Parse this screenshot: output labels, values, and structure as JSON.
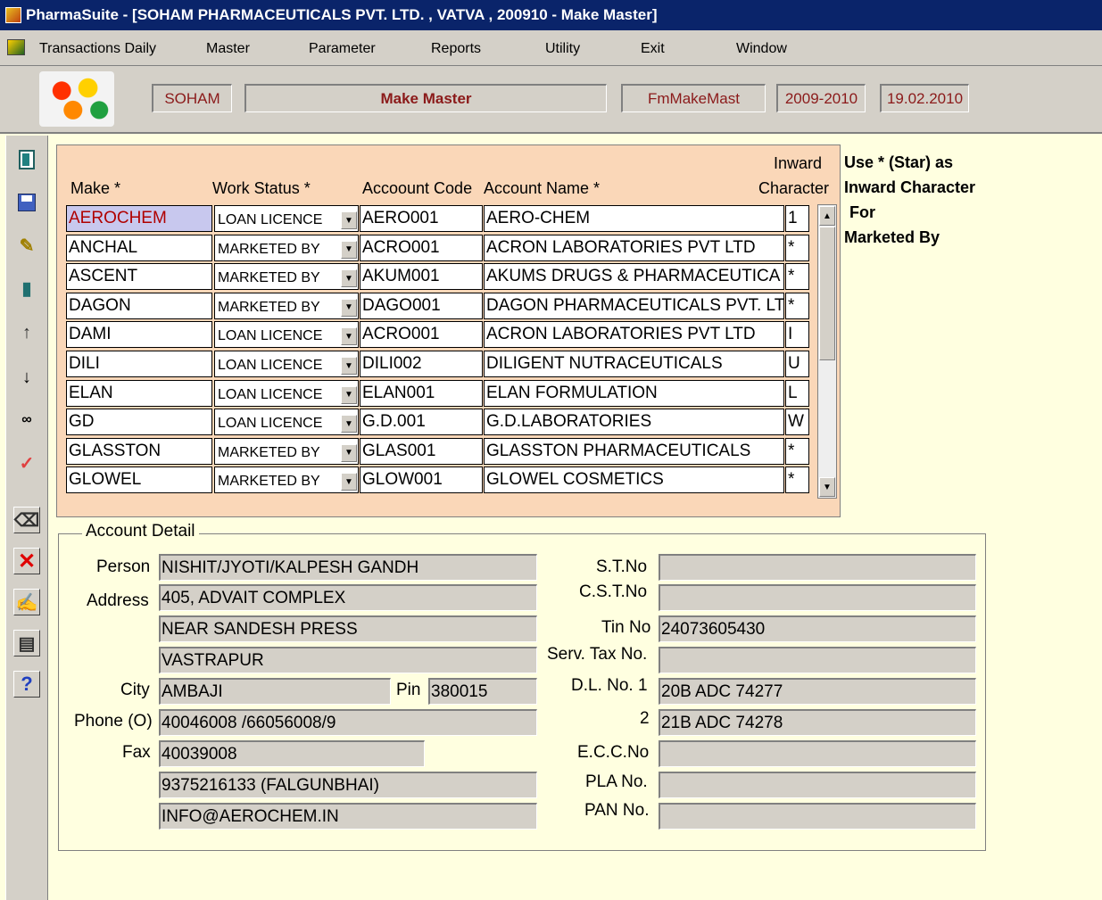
{
  "window": {
    "title": "PharmaSuite - [SOHAM PHARMACEUTICALS PVT. LTD. , VATVA , 200910 - Make Master]"
  },
  "menu": [
    "Transactions Daily",
    "Master",
    "Parameter",
    "Reports",
    "Utility",
    "Exit",
    "Window"
  ],
  "header": {
    "company": "SOHAM",
    "form_title": "Make Master",
    "form_code": "FmMakeMast",
    "year": "2009-2010",
    "date": "19.02.2010"
  },
  "toolbar": [
    "frame-icon",
    "save-icon",
    "edit-icon",
    "exit-door-icon",
    "arrow-up-icon",
    "arrow-down-icon",
    "binoculars-icon",
    "check-icon",
    "eraser-icon",
    "delete-icon",
    "pen-icon",
    "print-icon",
    "help-icon"
  ],
  "grid": {
    "headers": {
      "make": "Make *",
      "work_status": "Work Status *",
      "account_code": "Accoount Code",
      "account_name": "Account Name *",
      "inward_1": "Inward",
      "inward_2": "Character"
    },
    "rows": [
      {
        "make": "AEROCHEM",
        "status": "LOAN LICENCE",
        "code": "AERO001",
        "name": "AERO-CHEM",
        "inward": "1"
      },
      {
        "make": "ANCHAL",
        "status": "MARKETED BY",
        "code": "ACRO001",
        "name": "ACRON LABORATORIES PVT LTD",
        "inward": "*"
      },
      {
        "make": "ASCENT",
        "status": "MARKETED BY",
        "code": "AKUM001",
        "name": "AKUMS DRUGS & PHARMACEUTICA",
        "inward": "*"
      },
      {
        "make": "DAGON",
        "status": "MARKETED BY",
        "code": "DAGO001",
        "name": "DAGON PHARMACEUTICALS PVT. LT",
        "inward": "*"
      },
      {
        "make": "DAMI",
        "status": "LOAN LICENCE",
        "code": "ACRO001",
        "name": "ACRON LABORATORIES PVT LTD",
        "inward": "I"
      },
      {
        "make": "DILI",
        "status": "LOAN LICENCE",
        "code": "DILI002",
        "name": "DILIGENT NUTRACEUTICALS",
        "inward": "U"
      },
      {
        "make": "ELAN",
        "status": "LOAN LICENCE",
        "code": "ELAN001",
        "name": "ELAN FORMULATION",
        "inward": "L"
      },
      {
        "make": "GD",
        "status": "LOAN LICENCE",
        "code": "G.D.001",
        "name": "G.D.LABORATORIES",
        "inward": "W"
      },
      {
        "make": "GLASSTON",
        "status": "MARKETED BY",
        "code": "GLAS001",
        "name": "GLASSTON PHARMACEUTICALS",
        "inward": "*"
      },
      {
        "make": "GLOWEL",
        "status": "MARKETED BY",
        "code": "GLOW001",
        "name": "GLOWEL COSMETICS",
        "inward": "*"
      }
    ]
  },
  "hint": {
    "line1": "Use * (Star) as",
    "line2": "Inward Character",
    "line3": "For",
    "line4": "Marketed By"
  },
  "detail": {
    "legend": "Account Detail",
    "labels": {
      "person": "Person",
      "address": "Address",
      "city": "City",
      "pin": "Pin",
      "phone": "Phone (O)",
      "fax": "Fax",
      "st_no": "S.T.No",
      "cst_no": "C.S.T.No",
      "tin_no": "Tin No",
      "serv_tax": "Serv. Tax No.",
      "dl_no_1": "D.L. No. 1",
      "dl_no_2": "2",
      "ecc_no": "E.C.C.No",
      "pla_no": "PLA No.",
      "pan_no": "PAN No."
    },
    "values": {
      "person": "NISHIT/JYOTI/KALPESH GANDH",
      "address1": "405, ADVAIT COMPLEX",
      "address2": "NEAR SANDESH PRESS",
      "address3": "VASTRAPUR",
      "city": "AMBAJI",
      "pin": "380015",
      "phone": "40046008 /66056008/9",
      "fax": "40039008",
      "mobile": "9375216133 (FALGUNBHAI)",
      "email": "INFO@AEROCHEM.IN",
      "st_no": "",
      "cst_no": "",
      "tin_no": "24073605430",
      "serv_tax": "",
      "dl_no_1": "20B ADC 74277",
      "dl_no_2": "21B ADC 74278",
      "ecc_no": "",
      "pla_no": "",
      "pan_no": ""
    }
  }
}
